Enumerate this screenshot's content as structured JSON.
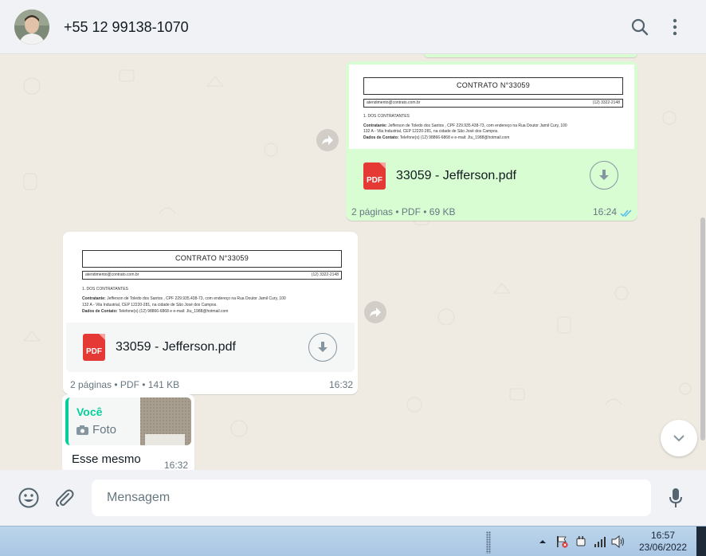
{
  "header": {
    "contact_name": "+55 12 99138-1070"
  },
  "messages": {
    "outgoing_doc": {
      "doc_title": "CONTRATO N°33059",
      "doc_email": "atendimento@contrato.com.br",
      "doc_phone": "(12) 3322-2148",
      "doc_section": "1. DOS CONTRATANTES",
      "doc_line1_label": "Contratante:",
      "doc_line1": "Jefferson de Toledo dos Santos , CPF 229.935.438-73, com endereço na Rua Doutor Jamil Cury, 100",
      "doc_line2": "132 A - Vila Industrial, CEP 12220-281, na cidade de São José dos Campos.",
      "doc_line3_label": "Dados de Contato:",
      "doc_line3": "Telefone(s) (12) 98866-6868 e e-mail: Jtu_1988@hotmail.com",
      "file_name": "33059 - Jefferson.pdf",
      "pdf_label": "PDF",
      "meta_pages": "2 páginas",
      "meta_type": "PDF",
      "meta_size": "69 KB",
      "time": "16:24"
    },
    "incoming_doc": {
      "doc_title": "CONTRATO N°33059",
      "doc_email": "atendimento@contrato.com.br",
      "doc_phone": "(12) 3322-2148",
      "doc_section": "1. DOS CONTRATANTES",
      "doc_line1_label": "Contratante:",
      "doc_line1": "Jefferson de Toledo dos Santos , CPF 229.935.438-73, com endereço na Rua Doutor Jamil Cury, 100",
      "doc_line2": "132 A - Vila Industrial, CEP 12220-281, na cidade de São José dos Campos.",
      "doc_line3_label": "Dados de Contato:",
      "doc_line3": "Telefone(s) (12) 98866-6868 e e-mail: Jtu_1988@hotmail.com",
      "file_name": "33059 - Jefferson.pdf",
      "pdf_label": "PDF",
      "meta_pages": "2 páginas",
      "meta_type": "PDF",
      "meta_size": "141 KB",
      "time": "16:32"
    },
    "reply": {
      "quote_author": "Você",
      "quote_type": "Foto",
      "text": "Esse mesmo",
      "time": "16:32"
    }
  },
  "footer": {
    "placeholder": "Mensagem"
  },
  "taskbar": {
    "time": "16:57",
    "date": "23/06/2022"
  },
  "colors": {
    "outgoing_bubble": "#d9fdd3",
    "incoming_bubble": "#ffffff",
    "chat_bg": "#efeae2",
    "accent": "#06cf9c",
    "pdf_red": "#e53935",
    "read_ticks": "#53bdeb"
  }
}
